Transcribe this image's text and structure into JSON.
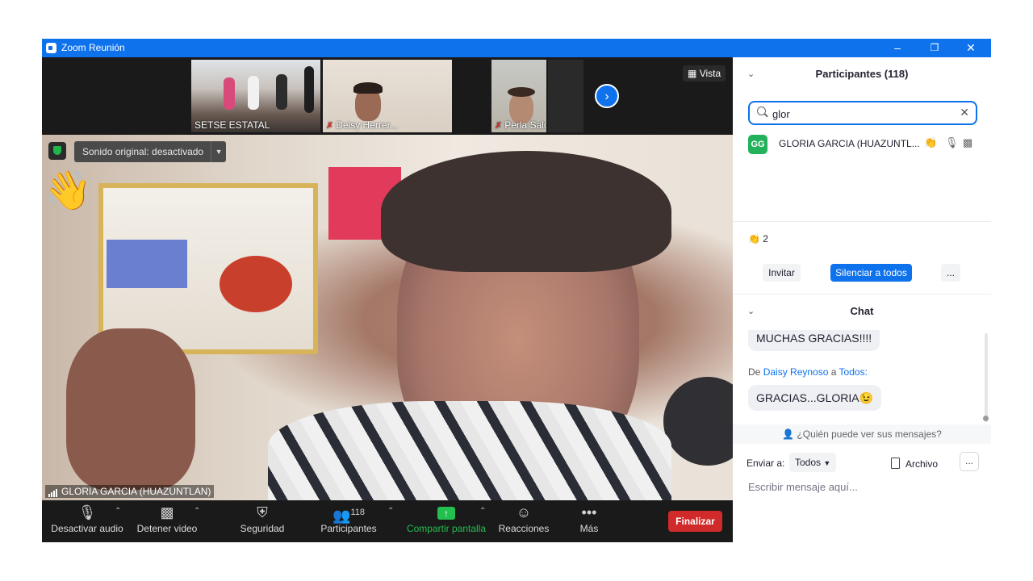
{
  "window": {
    "title": "Zoom Reunión"
  },
  "strip": {
    "thumbnails": [
      {
        "name": "SETSE ESTATAL",
        "muted": false
      },
      {
        "name": "Deisy Herrer...",
        "muted": true
      },
      {
        "name": "Perla Salomón",
        "muted": true
      }
    ],
    "view_label": "Vista"
  },
  "main_video": {
    "audio_label": "Sonido original: desactivado",
    "participant_name": "GLORIA GARCIA (HUAZUNTLAN)",
    "reaction": "👋"
  },
  "toolbar": {
    "mute_label": "Desactivar audio",
    "video_label": "Detener video",
    "security_label": "Seguridad",
    "participants_label": "Participantes",
    "participants_count": "118",
    "share_label": "Compartir pantalla",
    "reactions_label": "Reacciones",
    "more_label": "Más",
    "end_label": "Finalizar"
  },
  "participants_panel": {
    "title": "Participantes (118)",
    "search_value": "glor",
    "results": [
      {
        "initials": "GG",
        "name": "GLORIA GARCIA (HUAZUNTL...",
        "reaction": "👏"
      }
    ],
    "clap_count": "2",
    "invite_label": "Invitar",
    "mute_all_label": "Silenciar a todos",
    "more_label": "..."
  },
  "chat": {
    "title": "Chat",
    "messages": [
      {
        "text": "MUCHAS GRACIAS!!!!"
      },
      {
        "from_prefix": "De",
        "sender": "Daisy Reynoso",
        "to_prefix": "a",
        "recipient": "Todos:",
        "text": "GRACIAS...GLORIA😉"
      }
    ],
    "who_can_see": "¿Quién puede ver sus mensajes?",
    "send_to_label": "Enviar a:",
    "send_to_value": "Todos",
    "file_label": "Archivo",
    "more_label": "...",
    "input_placeholder": "Escribir mensaje aquí..."
  },
  "colors": {
    "zoom_blue": "#0e72ed",
    "end_red": "#d12a2a",
    "share_green": "#23c04f",
    "avatar_green": "#23b15b"
  }
}
